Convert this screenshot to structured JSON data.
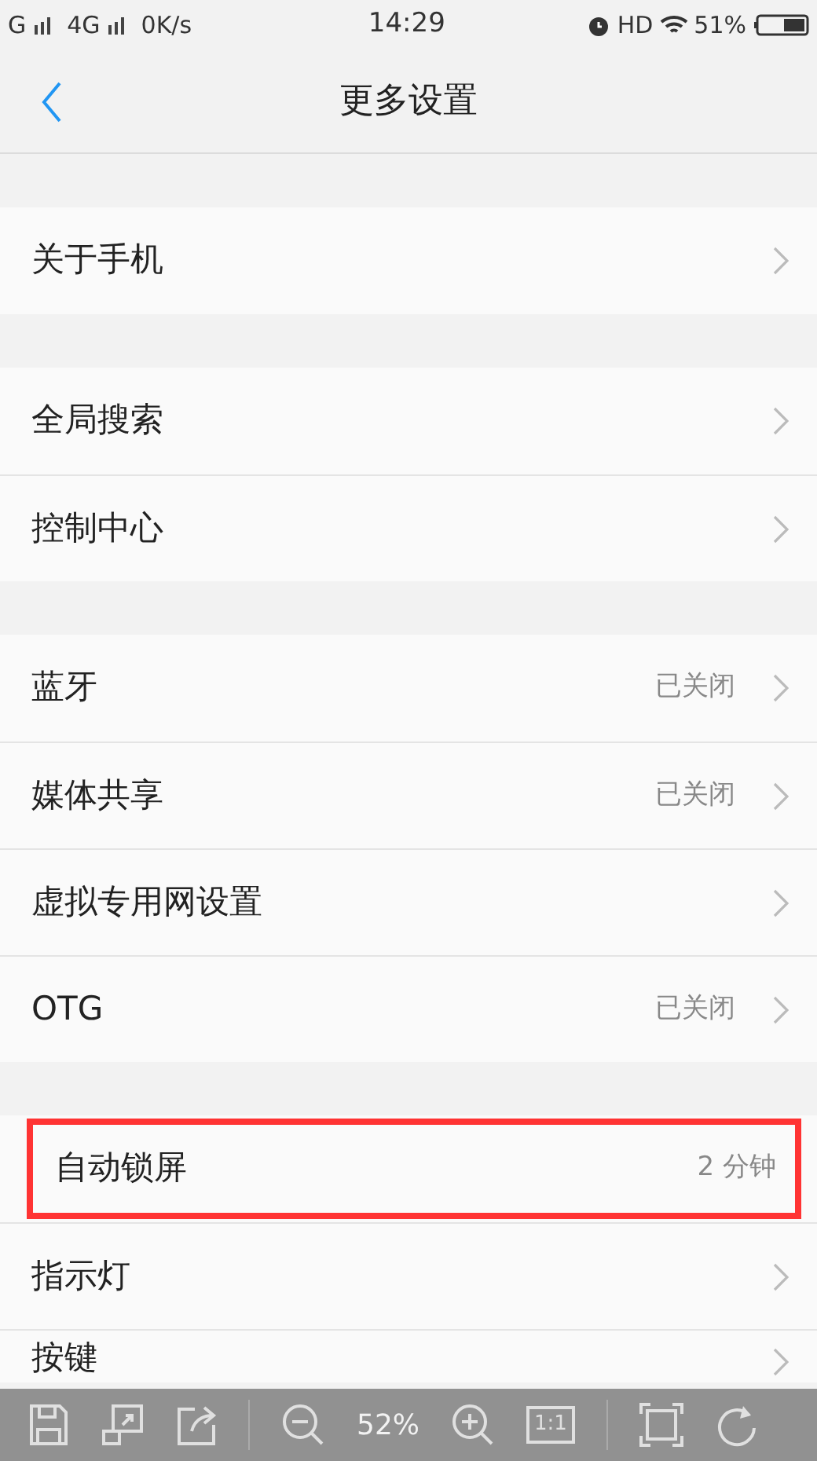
{
  "status_bar": {
    "carrier_1": "G",
    "carrier_2": "4G",
    "speed": "0K/s",
    "time": "14:29",
    "hd": "HD",
    "battery": "51%"
  },
  "header": {
    "title": "更多设置"
  },
  "sections": [
    {
      "rows": [
        {
          "label": "关于手机",
          "chevron": true,
          "highlighted": false
        }
      ]
    },
    {
      "rows": [
        {
          "label": "全局搜索",
          "chevron": true,
          "highlighted": false
        },
        {
          "label": "控制中心",
          "chevron": true,
          "highlighted": false
        }
      ]
    },
    {
      "rows": [
        {
          "label": "蓝牙",
          "value": "已关闭",
          "chevron": true,
          "highlighted": false
        },
        {
          "label": "媒体共享",
          "value": "已关闭",
          "chevron": true,
          "highlighted": false
        },
        {
          "label": "虚拟专用网设置",
          "chevron": true,
          "highlighted": false
        },
        {
          "label": "OTG",
          "value": "已关闭",
          "chevron": true,
          "highlighted": false
        }
      ]
    },
    {
      "rows": [
        {
          "label": "自动锁屏",
          "value": "2 分钟",
          "chevron": false,
          "highlighted": true
        },
        {
          "label": "指示灯",
          "chevron": true,
          "highlighted": false
        },
        {
          "label": "按键",
          "chevron": true,
          "highlighted": false
        }
      ]
    }
  ],
  "viewer_toolbar": {
    "zoom": "52%",
    "actual_size": "1:1"
  }
}
